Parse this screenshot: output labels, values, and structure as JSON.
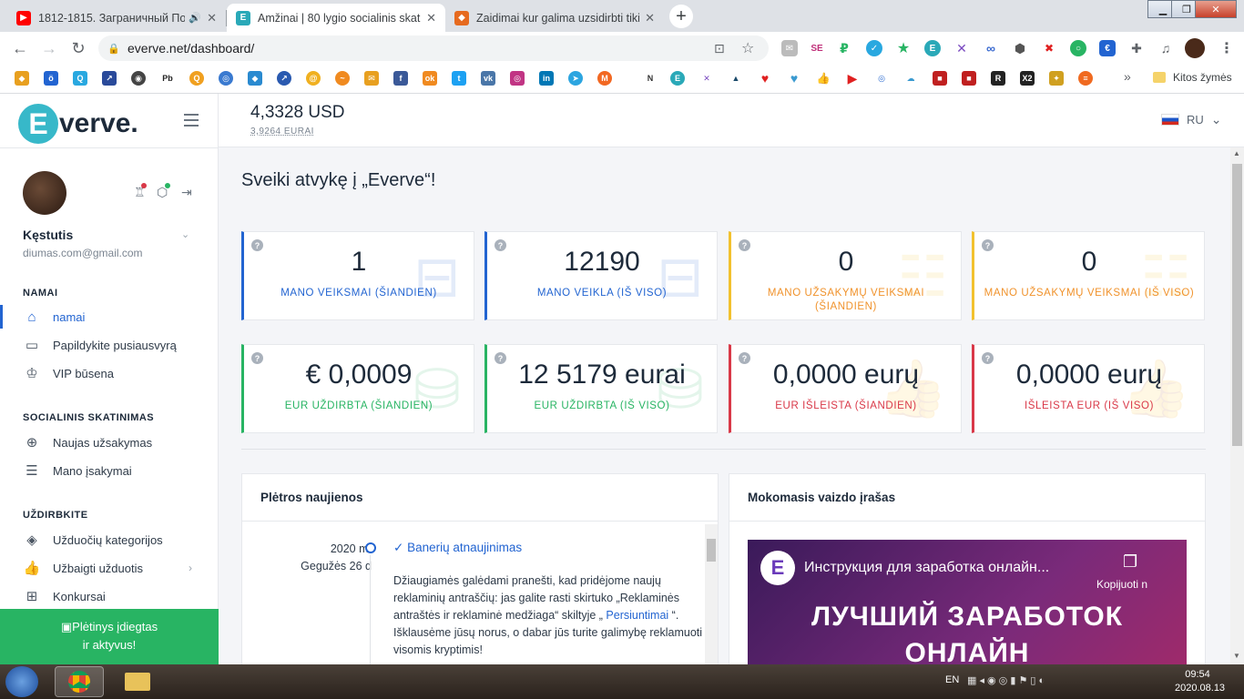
{
  "browser": {
    "tabs": [
      {
        "title": "1812-1815. Заграничный По",
        "favicon_color": "#ff0000"
      },
      {
        "title": "Amžinai | 80 lygio socialinis skati",
        "favicon_color": "#2aa9b8"
      },
      {
        "title": "Zaidimai kur galima uzsidirbti tiki",
        "favicon_color": "#e66a1f"
      }
    ],
    "url": "everve.net/dashboard/",
    "bookmarks_other": "Kitos žymės"
  },
  "app": {
    "logo_e": "E",
    "logo_rest": "verve.",
    "balance": "4,3328 USD",
    "balance_sub": "3,9264 EURAI",
    "lang": "RU"
  },
  "user": {
    "name": "Kęstutis",
    "email": "diumas.com@gmail.com"
  },
  "sidebar": {
    "sec_home": "NAMAI",
    "sec_social": "SOCIALINIS SKATINIMAS",
    "sec_earn": "UŽDIRBKITE",
    "items": [
      {
        "label": "namai",
        "icon": "home-icon"
      },
      {
        "label": "Papildykite pusiausvyrą",
        "icon": "card-icon"
      },
      {
        "label": "VIP būsena",
        "icon": "award-icon"
      },
      {
        "label": "Naujas užsakymas",
        "icon": "plus-circle-icon"
      },
      {
        "label": "Mano įsakymai",
        "icon": "list-icon"
      },
      {
        "label": "Užduočių kategorijos",
        "icon": "layers-icon"
      },
      {
        "label": "Užbaigti užduotis",
        "icon": "thumb-up-icon"
      },
      {
        "label": "Konkursai",
        "icon": "gift-icon"
      }
    ],
    "ext_line1": "Plėtinys įdiegtas",
    "ext_line2": "ir aktyvus!"
  },
  "main": {
    "welcome": "Sveiki atvykę į „Everve“!",
    "cards": [
      {
        "value": "1",
        "label": "MANO VEIKSMAI (ŠIANDIEN)"
      },
      {
        "value": "12190",
        "label": "MANO VEIKLA (IŠ VISO)"
      },
      {
        "value": "0",
        "label": "MANO UŽSAKYMŲ VEIKSMAI (ŠIANDIEN)"
      },
      {
        "value": "0",
        "label": "MANO UŽSAKYMŲ VEIKSMAI (IŠ VISO)"
      },
      {
        "value": "€ 0,0009",
        "label": "EUR UŽDIRBTA (ŠIANDIEN)"
      },
      {
        "value": "12 5179 eurai",
        "label": "EUR UŽDIRBTA (IŠ VISO)"
      },
      {
        "value": "0,0000 eurų",
        "label": "EUR IŠLEISTA (ŠIANDIEN)"
      },
      {
        "value": "0,0000 eurų",
        "label": "IŠLEISTA EUR (IŠ VISO)"
      }
    ],
    "news": {
      "title": "Plėtros naujienos",
      "date_line1": "2020 m.",
      "date_line2": "Gegužės 26 d",
      "item_title": "Banerių atnaujinimas",
      "body_pre": "Džiaugiamės galėdami pranešti, kad pridėjome naujų reklaminių antraščių: jas galite rasti skirtuko „Reklaminės antraštės ir reklaminė medžiaga“ skiltyje „ ",
      "body_link": "Persiuntimai",
      "body_post": " “. Išklausėme jūsų norus, o dabar jūs turite galimybę reklamuoti visomis kryptimis!"
    },
    "video": {
      "title": "Mokomasis vaizdo įrašas",
      "video_title": "Инструкция для заработка онлайн...",
      "copy": "Kopijuoti n",
      "line1": "ЛУЧШИЙ ЗАРАБОТОК",
      "line2": "ОНЛАЙН"
    }
  },
  "taskbar": {
    "lang": "EN",
    "time": "09:54",
    "date": "2020.08.13"
  }
}
